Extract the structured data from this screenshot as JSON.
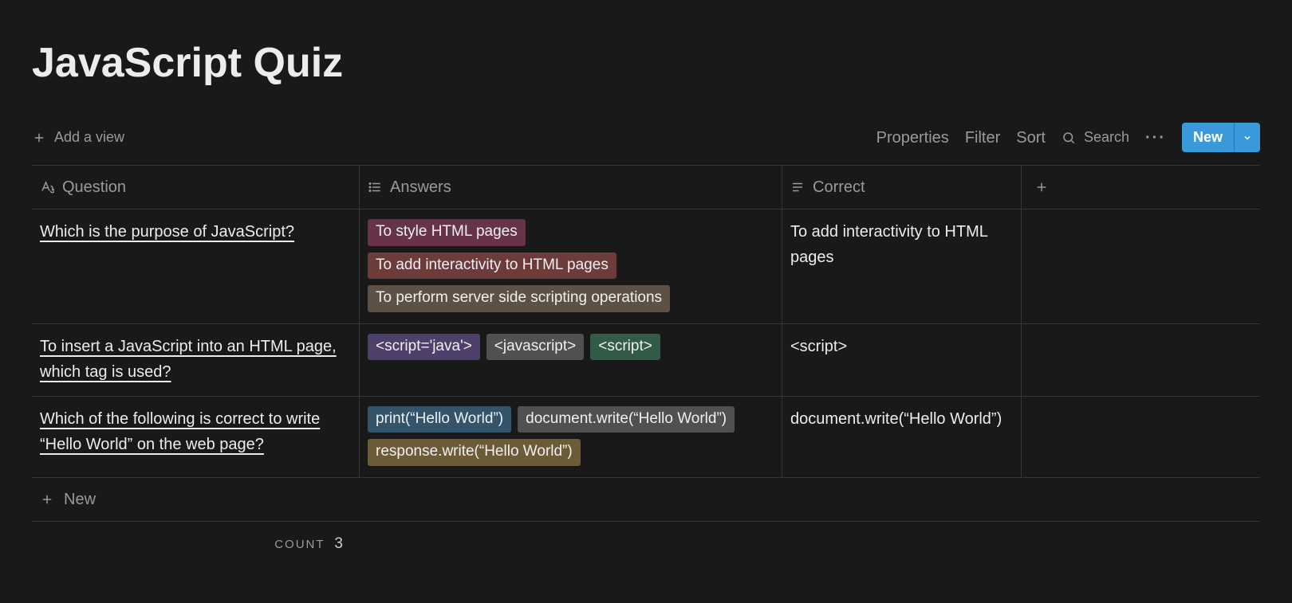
{
  "page": {
    "title": "JavaScript Quiz"
  },
  "toolbar": {
    "add_view": "Add a view",
    "properties": "Properties",
    "filter": "Filter",
    "sort": "Sort",
    "search": "Search",
    "new_label": "New"
  },
  "columns": {
    "question": "Question",
    "answers": "Answers",
    "correct": "Correct"
  },
  "rows": [
    {
      "question": "Which is the purpose of JavaScript?",
      "answers": [
        {
          "text": "To style HTML pages",
          "colorClass": "c-pink"
        },
        {
          "text": "To add interactivity to HTML pages",
          "colorClass": "c-red"
        },
        {
          "text": "To perform server side scripting operations",
          "colorClass": "c-brown"
        }
      ],
      "correct": "To add interactivity to HTML pages"
    },
    {
      "question": "To insert a JavaScript into an HTML page, which tag is used?",
      "answers": [
        {
          "text": "<script='java'>",
          "colorClass": "c-purple"
        },
        {
          "text": "<javascript>",
          "colorClass": "c-gray"
        },
        {
          "text": "<script>",
          "colorClass": "c-green"
        }
      ],
      "correct": "<script>"
    },
    {
      "question": "Which of the following is correct to write “Hello World” on the web page?",
      "answers": [
        {
          "text": "print(“Hello World”)",
          "colorClass": "c-blue"
        },
        {
          "text": "document.write(“Hello World”)",
          "colorClass": "c-gray"
        },
        {
          "text": "response.write(“Hello World”)",
          "colorClass": "c-olive"
        }
      ],
      "correct": "document.write(“Hello World”)"
    }
  ],
  "footer": {
    "add_new": "New",
    "count_label": "COUNT",
    "count_value": "3"
  }
}
